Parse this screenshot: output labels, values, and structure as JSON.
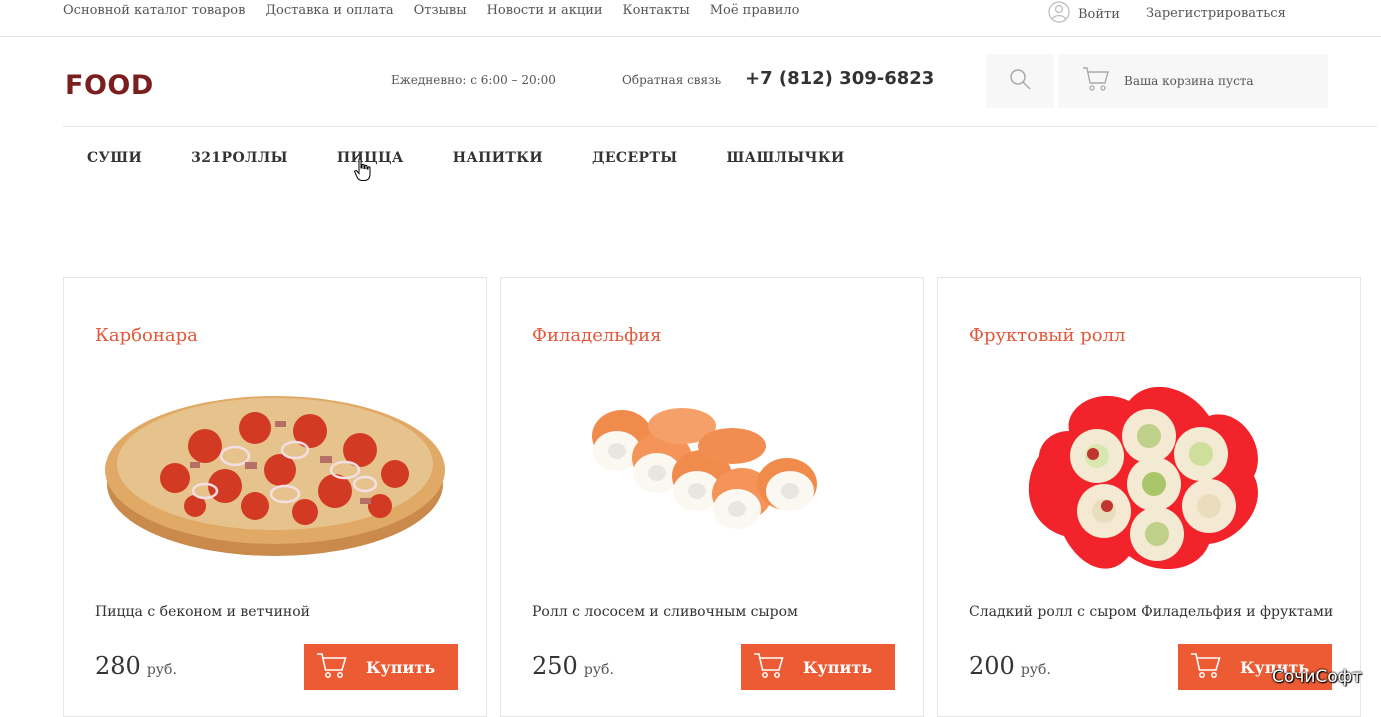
{
  "topbar": {
    "links": [
      "Основной каталог товаров",
      "Доставка и оплата",
      "Отзывы",
      "Новости и акции",
      "Контакты",
      "Моё правило"
    ],
    "login_label": "Войти",
    "register_label": "Зарегистрироваться"
  },
  "header": {
    "logo": "FOOD",
    "hours": "Ежедневно: с 6:00 – 20:00",
    "feedback": "Обратная связь",
    "phone": "+7 (812) 309-6823",
    "cart_text": "Ваша корзина пуста"
  },
  "nav": {
    "items": [
      "СУШИ",
      "321РОЛЛЫ",
      "ПИЦЦА",
      "НАПИТКИ",
      "ДЕСЕРТЫ",
      "ШАШЛЫЧКИ"
    ]
  },
  "products": [
    {
      "title": "Карбонара",
      "description": "Пицца с беконом и ветчиной",
      "price": "280",
      "currency": "руб.",
      "buy_label": "Купить",
      "image": "pizza"
    },
    {
      "title": "Филадельфия",
      "description": "Ролл с лососем и сливочным сыром",
      "price": "250",
      "currency": "руб.",
      "buy_label": "Купить",
      "image": "salmon-rolls"
    },
    {
      "title": "Фруктовый ролл",
      "description": "Сладкий ролл с сыром Филадельфия и фруктами",
      "price": "200",
      "currency": "руб.",
      "buy_label": "Купить",
      "image": "fruit-rolls"
    }
  ],
  "watermark": "СочиСофт",
  "colors": {
    "accent": "#ec5b34",
    "title": "#e2583a",
    "logo": "#7a1f1f",
    "panel": "#f7f7f7"
  }
}
